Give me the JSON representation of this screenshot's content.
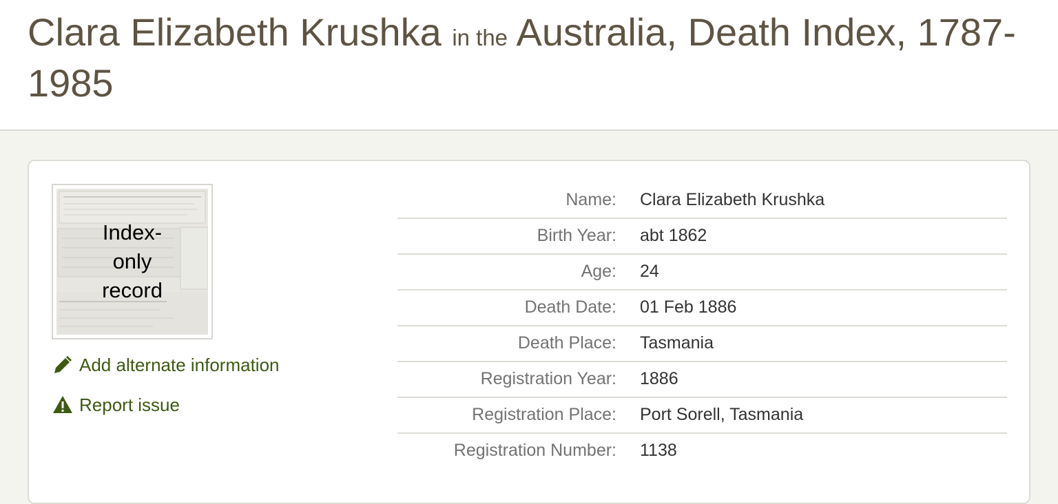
{
  "header": {
    "name": "Clara Elizabeth Krushka",
    "connector": "in the",
    "collection": "Australia, Death Index, 1787-1985"
  },
  "thumbnail": {
    "label": "Index-only record"
  },
  "actions": {
    "add_alternate": "Add alternate information",
    "report_issue": "Report issue"
  },
  "icons": {
    "edit": "pencil-icon",
    "report": "warning-icon"
  },
  "colors": {
    "title": "#5e5443",
    "link": "#3d5a12",
    "label": "#737373",
    "value": "#333333"
  },
  "details": [
    {
      "label": "Name:",
      "value": "Clara Elizabeth Krushka"
    },
    {
      "label": "Birth Year:",
      "value": "abt 1862"
    },
    {
      "label": "Age:",
      "value": "24"
    },
    {
      "label": "Death Date:",
      "value": "01 Feb 1886"
    },
    {
      "label": "Death Place:",
      "value": "Tasmania"
    },
    {
      "label": "Registration Year:",
      "value": "1886"
    },
    {
      "label": "Registration Place:",
      "value": "Port Sorell, Tasmania"
    },
    {
      "label": "Registration Number:",
      "value": "1138"
    }
  ]
}
